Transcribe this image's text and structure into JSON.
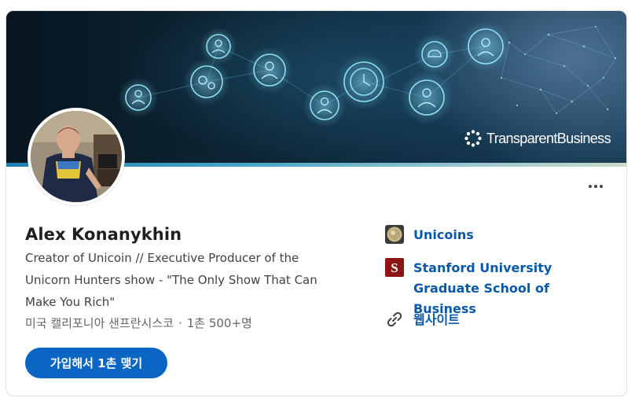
{
  "banner": {
    "brand_text": "TransparentBusiness"
  },
  "profile": {
    "name": "Alex Konanykhin",
    "headline": "Creator of Unicoin // Executive Producer of the Unicorn Hunters show - \"The Only Show That Can Make You Rich\"",
    "location": "미국 캘리포니아 샌프란시스코",
    "separator": "·",
    "connections": "1촌 500+명",
    "connect_label": "가입해서 1촌 맺기"
  },
  "links": {
    "company": "Unicoins",
    "school": "Stanford University Graduate School of Business",
    "website": "웹사이트"
  },
  "colors": {
    "accent": "#0a66c2",
    "link": "#0a59a8",
    "stanford": "#8c1515"
  }
}
